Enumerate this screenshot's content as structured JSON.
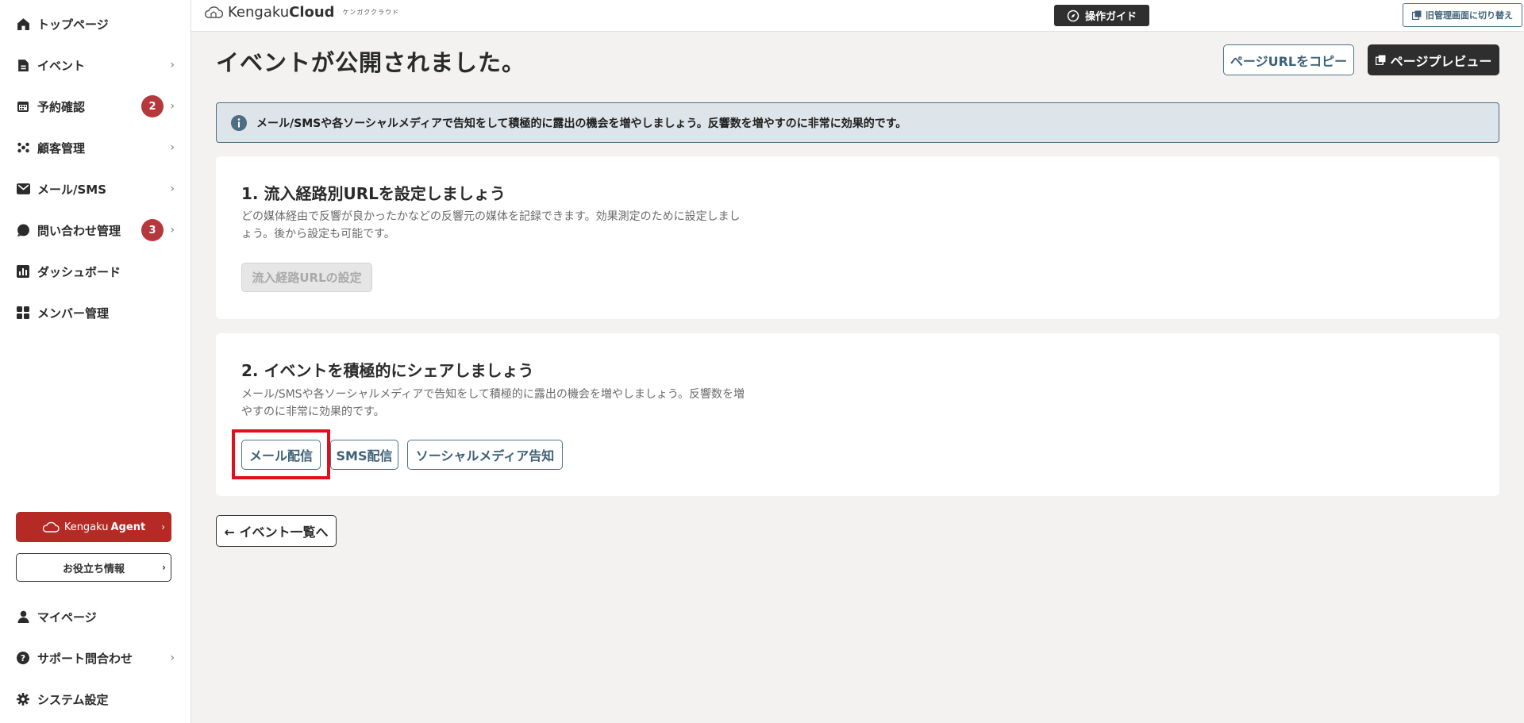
{
  "header": {
    "logo_main": "Kengaku",
    "logo_bold": "Cloud",
    "logo_sub": "ケンガククラウド",
    "guide_label": "操作ガイド",
    "legacy_label": "旧管理画面に切り替え"
  },
  "sidebar": {
    "items": [
      {
        "label": "トップページ",
        "icon": "home-icon",
        "chevron": false
      },
      {
        "label": "イベント",
        "icon": "document-icon",
        "chevron": true
      },
      {
        "label": "予約確認",
        "icon": "calendar-icon",
        "chevron": true,
        "badge": "2"
      },
      {
        "label": "顧客管理",
        "icon": "people-icon",
        "chevron": true
      },
      {
        "label": "メール/SMS",
        "icon": "mail-icon",
        "chevron": true
      },
      {
        "label": "問い合わせ管理",
        "icon": "chat-icon",
        "chevron": true,
        "badge": "3"
      },
      {
        "label": "ダッシュボード",
        "icon": "chart-icon",
        "chevron": false
      },
      {
        "label": "メンバー管理",
        "icon": "grid-icon",
        "chevron": false
      }
    ],
    "agent_prefix": "Kengaku",
    "agent_bold": "Agent",
    "tips_label": "お役立ち情報",
    "bottom_items": [
      {
        "label": "マイページ",
        "icon": "user-icon",
        "chevron": false
      },
      {
        "label": "サポート問合わせ",
        "icon": "help-icon",
        "chevron": true
      },
      {
        "label": "システム設定",
        "icon": "gear-icon",
        "chevron": false
      }
    ]
  },
  "main": {
    "title": "イベントが公開されました。",
    "copy_url_label": "ページURLをコピー",
    "preview_label": "ページプレビュー",
    "info_text": "メール/SMSや各ソーシャルメディアで告知をして積極的に露出の機会を増やしましょう。反響数を増やすのに非常に効果的です。",
    "step1": {
      "heading": "1. 流入経路別URLを設定しましょう",
      "description": "どの媒体経由で反響が良かったかなどの反響元の媒体を記録できます。効果測定のために設定しましょう。後から設定も可能です。",
      "button_label": "流入経路URLの設定"
    },
    "step2": {
      "heading": "2. イベントを積極的にシェアしましょう",
      "description": "メール/SMSや各ソーシャルメディアで告知をして積極的に露出の機会を増やしましょう。反響数を増やすのに非常に効果的です。",
      "mail_label": "メール配信",
      "sms_label": "SMS配信",
      "social_label": "ソーシャルメディア告知"
    },
    "back_label": "← イベント一覧へ"
  },
  "colors": {
    "accent": "#4e7389",
    "badge": "#b5383d",
    "agent": "#b52a24",
    "highlight": "#e0101a"
  }
}
